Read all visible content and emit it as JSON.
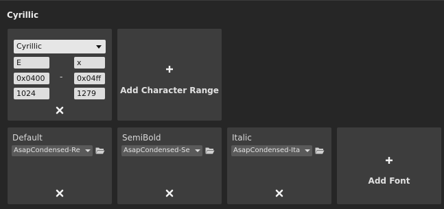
{
  "section": {
    "title": "Cyrillic"
  },
  "range_card": {
    "dropdown_value": "Cyrillic",
    "char_from": "E",
    "char_to": "x",
    "hex_from": "0x0400",
    "hex_to": "0x04ff",
    "dec_from": "1024",
    "dec_to": "1279",
    "separator": "-"
  },
  "add_range": {
    "label": "Add Character Range"
  },
  "fonts": [
    {
      "label": "Default",
      "asset": "AsapCondensed-Re"
    },
    {
      "label": "SemiBold",
      "asset": "AsapCondensed-Se"
    },
    {
      "label": "Italic",
      "asset": "AsapCondensed-Ita"
    }
  ],
  "add_font": {
    "label": "Add Font"
  },
  "colors": {
    "card": "#3d3d3d",
    "panel": "#262626",
    "field": "#dedede"
  }
}
